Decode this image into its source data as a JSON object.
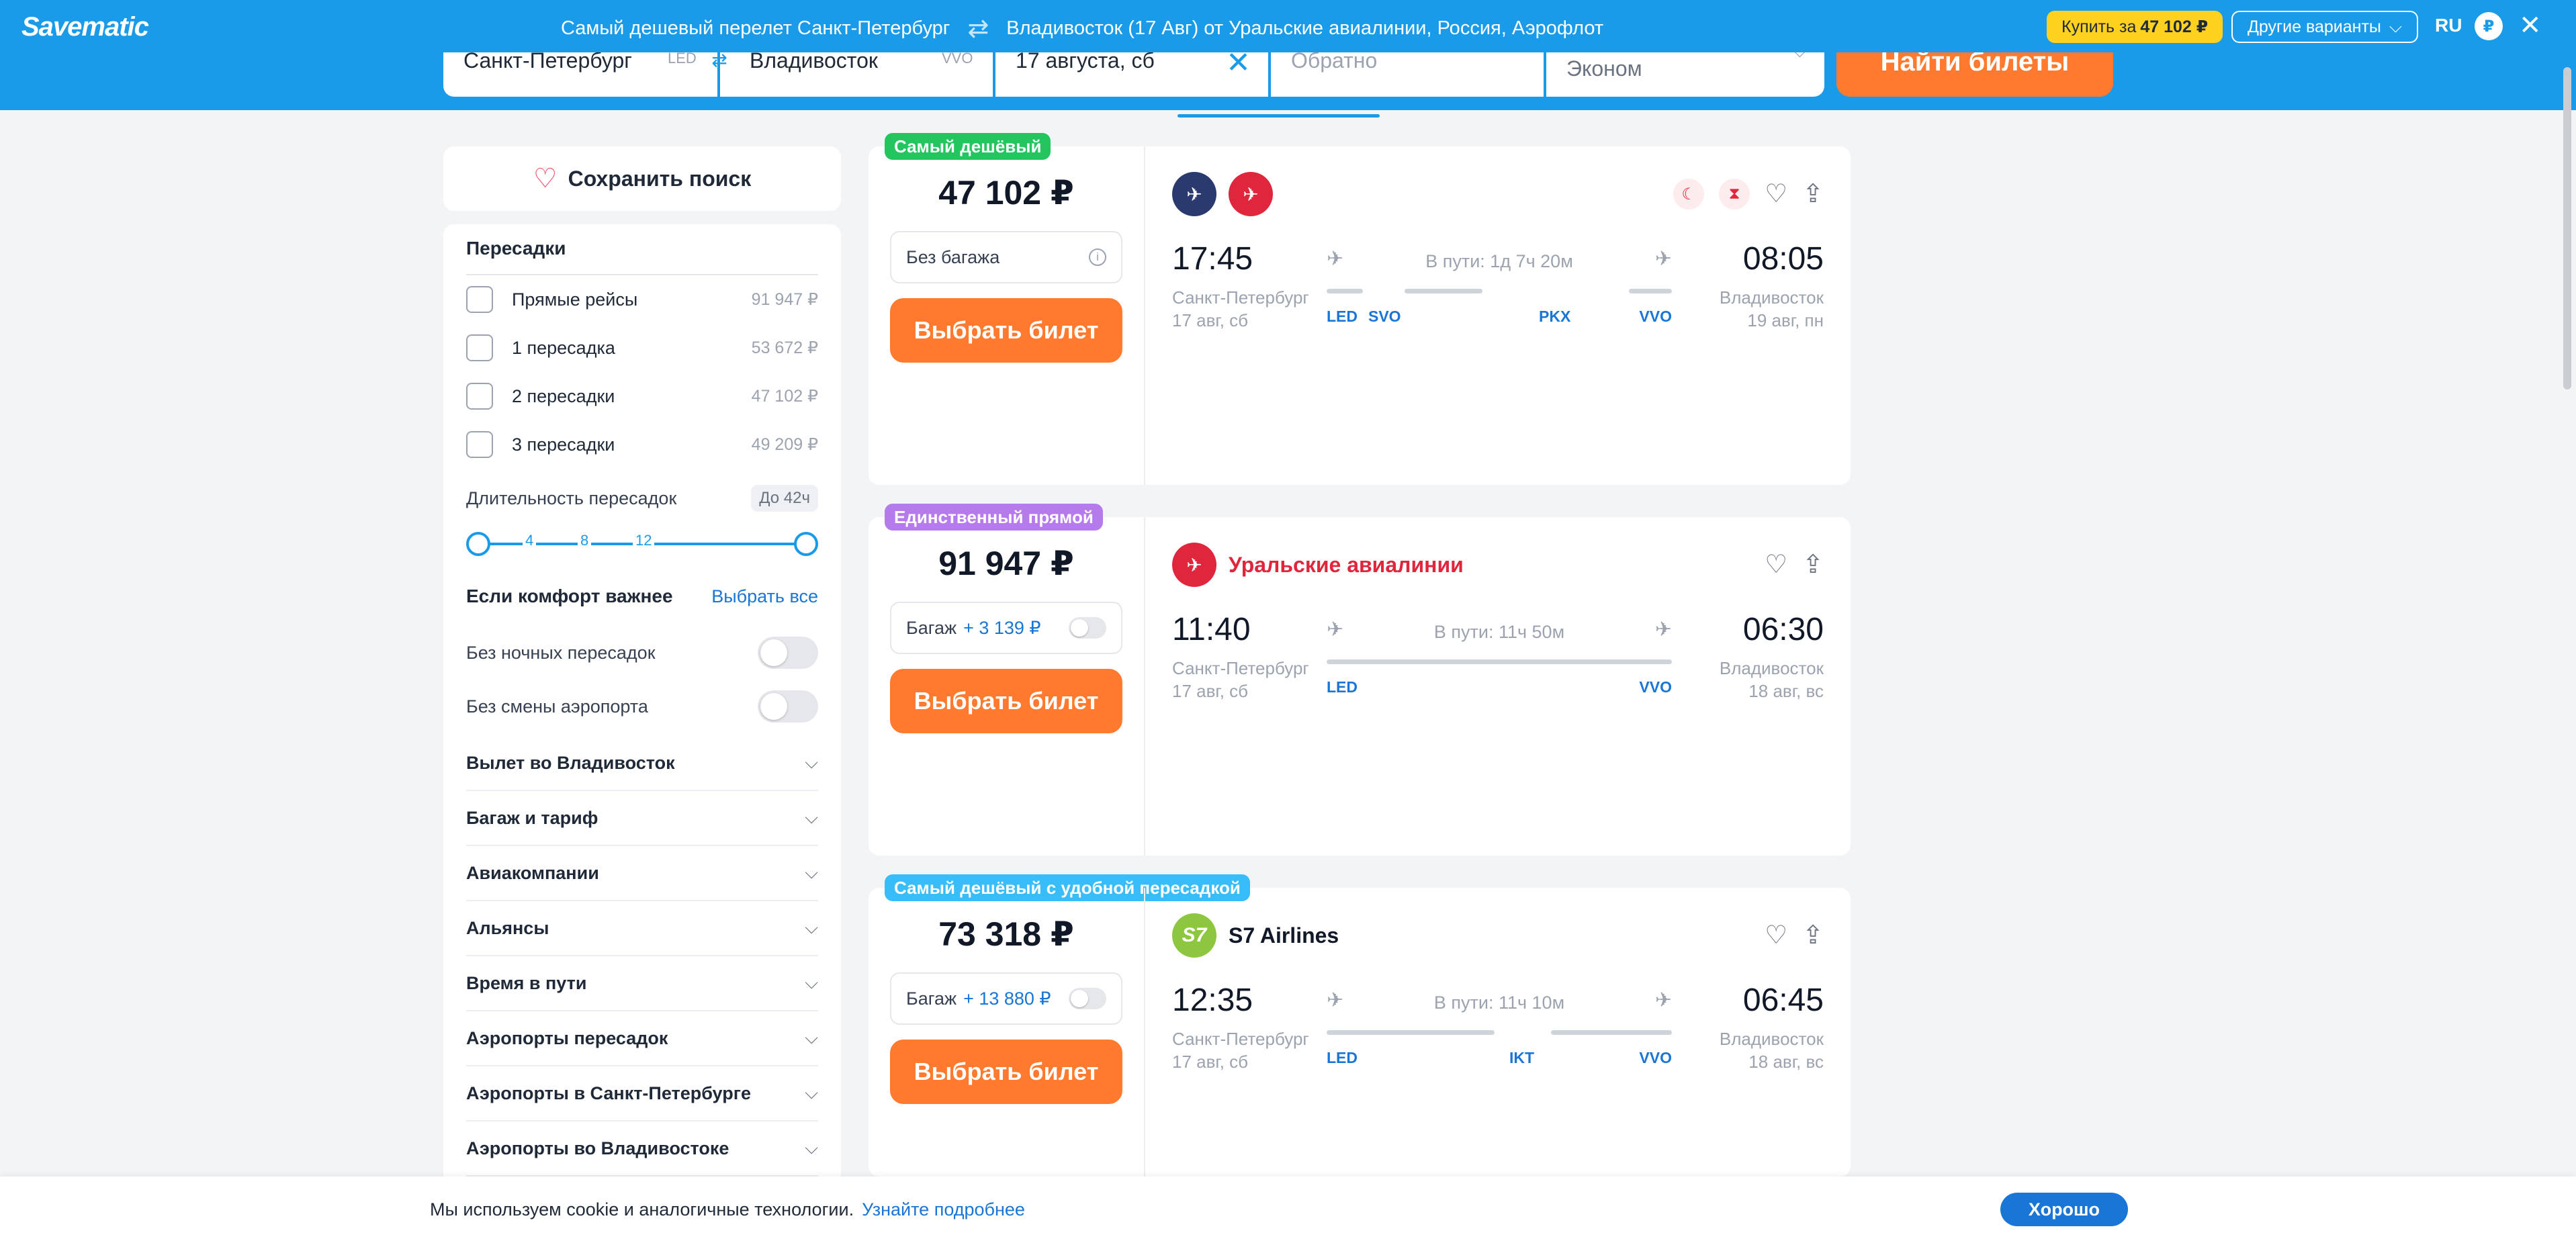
{
  "topbar": {
    "logo": "Savematic",
    "promo_from": "Самый дешевый перелет Санкт-Петербург",
    "promo_to": "Владивосток (17 Авг) от Уральские авиалинии, Россия, Аэрофлот",
    "buy_label": "Купить за",
    "buy_price": "47 102 ₽",
    "other_label": "Другие варианты",
    "lang": "RU",
    "currency": "₽"
  },
  "search": {
    "from_city": "Санкт-Петербург",
    "from_code": "LED",
    "to_city": "Владивосток",
    "to_code": "VVO",
    "date": "17 августа, сб",
    "return_placeholder": "Обратно",
    "class": "Эконом",
    "find_label": "Найти билеты"
  },
  "filters": {
    "save_search": "Сохранить поиск",
    "transfers_title": "Пересадки",
    "transfers": [
      {
        "label": "Прямые рейсы",
        "price": "91 947 ₽"
      },
      {
        "label": "1 пересадка",
        "price": "53 672 ₽"
      },
      {
        "label": "2 пересадки",
        "price": "47 102 ₽"
      },
      {
        "label": "3 пересадки",
        "price": "49 209 ₽"
      }
    ],
    "duration_label": "Длительность пересадок",
    "duration_value": "До 42ч",
    "slider_ticks": [
      "4",
      "8",
      "12"
    ],
    "comfort_title": "Если комфорт важнее",
    "select_all": "Выбрать все",
    "no_night": "Без ночных пересадок",
    "no_airport_change": "Без смены аэропорта",
    "accordions": [
      "Вылет во Владивосток",
      "Багаж и тариф",
      "Авиакомпании",
      "Альянсы",
      "Время в пути",
      "Аэропорты пересадок",
      "Аэропорты в Санкт-Петербурге",
      "Аэропорты во Владивостоке"
    ]
  },
  "tickets": [
    {
      "badge": "Самый дешёвый",
      "price": "47 102 ₽",
      "baggage": "Без багажа",
      "choose": "Выбрать билет",
      "dep_time": "17:45",
      "arr_time": "08:05",
      "dep_city": "Санкт-Петербург",
      "dep_date": "17 авг, сб",
      "arr_city": "Владивосток",
      "arr_date": "19 авг, пн",
      "duration": "В пути: 1д 7ч 20м",
      "codes": [
        "LED",
        "SVO",
        "PKX",
        "VVO"
      ]
    },
    {
      "badge": "Единственный прямой",
      "price": "91 947 ₽",
      "baggage": "Багаж",
      "baggage_plus": "+ 3 139 ₽",
      "choose": "Выбрать билет",
      "airline": "Уральские авиалинии",
      "dep_time": "11:40",
      "arr_time": "06:30",
      "dep_city": "Санкт-Петербург",
      "dep_date": "17 авг, сб",
      "arr_city": "Владивосток",
      "arr_date": "18 авг, вс",
      "duration": "В пути: 11ч 50м",
      "codes": [
        "LED",
        "VVO"
      ]
    },
    {
      "badge": "Самый дешёвый с удобной пересадкой",
      "price": "73 318 ₽",
      "baggage": "Багаж",
      "baggage_plus": "+ 13 880 ₽",
      "choose": "Выбрать билет",
      "airline": "S7 Airlines",
      "dep_time": "12:35",
      "arr_time": "06:45",
      "dep_city": "Санкт-Петербург",
      "dep_date": "17 авг, сб",
      "arr_city": "Владивосток",
      "arr_date": "18 авг, вс",
      "duration": "В пути: 11ч 10м",
      "codes": [
        "LED",
        "IKT",
        "VVO"
      ]
    }
  ],
  "cookie": {
    "text": "Мы используем cookie и аналогичные технологии.",
    "link": "Узнайте подробнее",
    "ok": "Хорошо"
  },
  "colors": {
    "brand_blue": "#1a9bea",
    "accent_orange": "#ff7a2e",
    "buy_yellow": "#ffd21f",
    "link_blue": "#1a76d6"
  },
  "icons": [
    "heart-icon",
    "swap-icon",
    "close-icon",
    "chevron-down-icon",
    "plane-takeoff-icon",
    "plane-landing-icon",
    "share-icon",
    "info-icon",
    "moon-icon",
    "hourglass-icon"
  ]
}
